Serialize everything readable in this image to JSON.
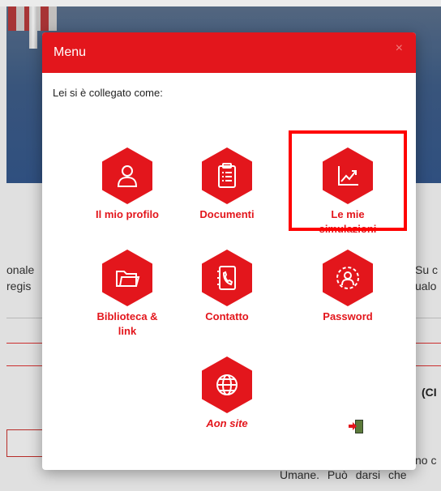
{
  "background": {
    "left_text": [
      "onale",
      "regis"
    ],
    "right_text": [
      "Su c",
      "ualo"
    ],
    "bold_text": "(CI",
    "bottom_text": "Umane. Può darsi che",
    "bottom_text_right": "no c"
  },
  "modal": {
    "title": "Menu",
    "close_label": "×",
    "logged_in_label": "Lei si è collegato come:",
    "tiles": [
      {
        "label_line1": "Il mio profilo",
        "label_line2": "",
        "icon": "user-profile-icon"
      },
      {
        "label_line1": "Documenti",
        "label_line2": "",
        "icon": "clipboard-list-icon"
      },
      {
        "label_line1": "Le mie",
        "label_line2": "simulazioni",
        "icon": "chart-line-icon"
      },
      {
        "label_line1": "Biblioteca &",
        "label_line2": "link",
        "icon": "folder-icon"
      },
      {
        "label_line1": "Contatto",
        "label_line2": "",
        "icon": "phone-book-icon"
      },
      {
        "label_line1": "Password",
        "label_line2": "",
        "icon": "user-gear-icon"
      },
      {
        "label_line1": "Aon site",
        "label_line2": "",
        "icon": "globe-icon"
      }
    ],
    "logout_icon": "logout-icon"
  },
  "colors": {
    "brand_red": "#e3161c",
    "highlight": "#ff0000"
  }
}
